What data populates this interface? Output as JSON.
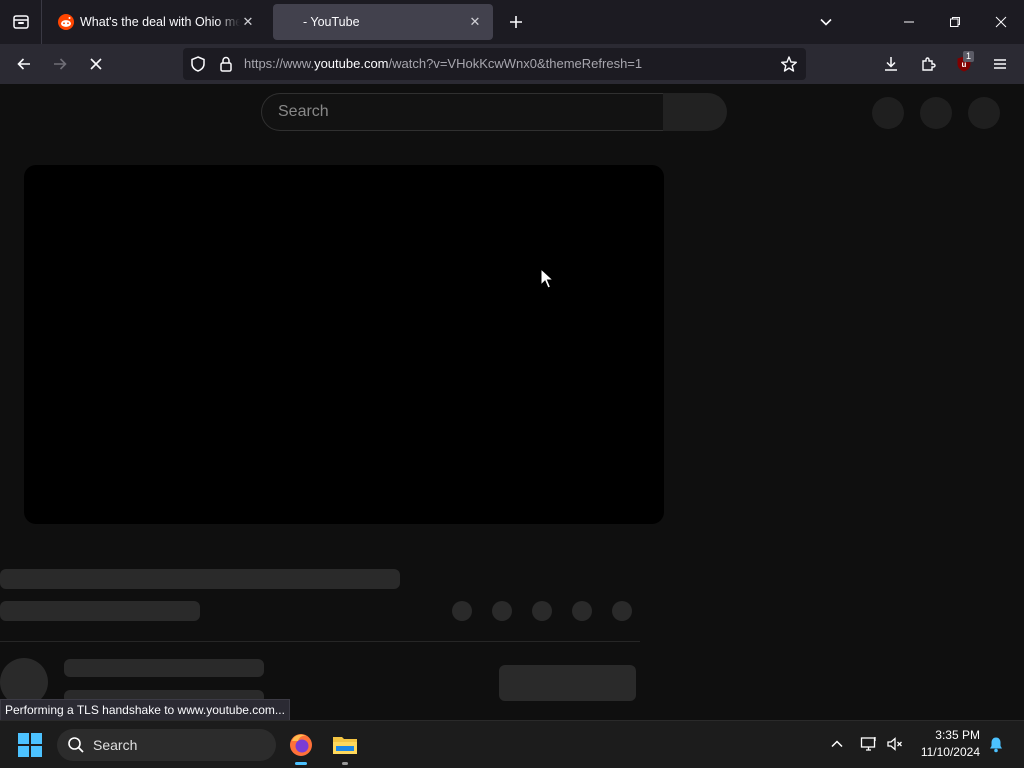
{
  "browser": {
    "tabs": [
      {
        "title": "What's the deal with Ohio meme",
        "active": false
      },
      {
        "title": "- YouTube",
        "active": true
      }
    ],
    "url": {
      "prefix": "https://www.",
      "domain": "youtube.com",
      "suffix": "/watch?v=VHokKcwWnx0&themeRefresh=1"
    },
    "extension_badge": "1",
    "status_text": "Performing a TLS handshake to www.youtube.com..."
  },
  "youtube": {
    "search_placeholder": "Search"
  },
  "taskbar": {
    "search_label": "Search",
    "time": "3:35 PM",
    "date": "11/10/2024"
  },
  "colors": {
    "browser_tabstrip": "#1c1b22",
    "browser_toolbar": "#2b2a33",
    "page_background": "#0f0f0f",
    "skeleton": "#2a2a2a",
    "reddit_orange": "#ff4500",
    "ublock_red": "#800000"
  }
}
